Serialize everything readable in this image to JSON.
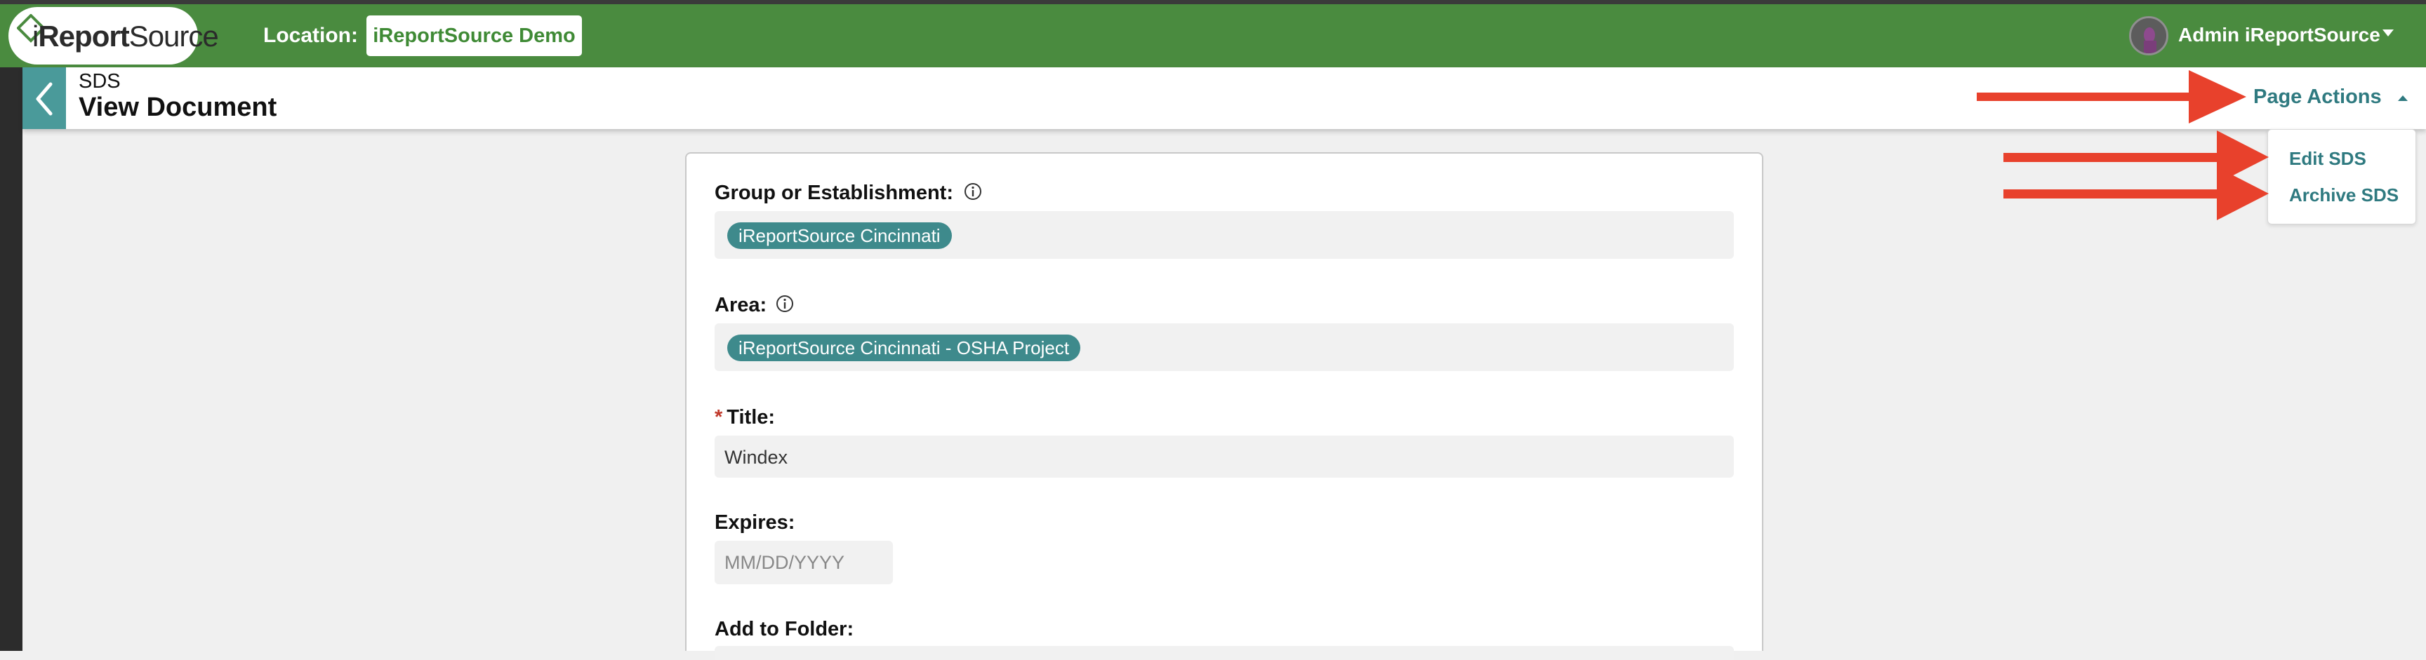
{
  "navbar": {
    "logo_prefix": "i",
    "logo_bold": "Report",
    "logo_suffix": "Source",
    "location_label": "Location:",
    "location_value": "iReportSource Demo",
    "user_name": "Admin iReportSource"
  },
  "subheader": {
    "breadcrumb": "SDS",
    "title": "View Document",
    "page_actions_label": "Page Actions"
  },
  "page_actions_menu": {
    "items": [
      {
        "label": "Edit SDS"
      },
      {
        "label": "Archive SDS"
      }
    ]
  },
  "form": {
    "group_label": "Group or Establishment:",
    "group_tag": "iReportSource Cincinnati",
    "area_label": "Area:",
    "area_tag": "iReportSource Cincinnati - OSHA Project",
    "title_required_mark": "*",
    "title_label": "Title:",
    "title_value": "Windex",
    "expires_label": "Expires:",
    "expires_placeholder": "MM/DD/YYYY",
    "folder_label": "Add to Folder:"
  },
  "colors": {
    "nav_green": "#4a8b3f",
    "teal": "#2f7a80",
    "tag_teal": "#3e8a8c",
    "arrow_red": "#e8412c"
  },
  "icons": [
    "back-chevron-icon",
    "info-icon",
    "caret-down-icon",
    "caret-up-icon",
    "user-avatar",
    "red-arrow-annotation"
  ]
}
